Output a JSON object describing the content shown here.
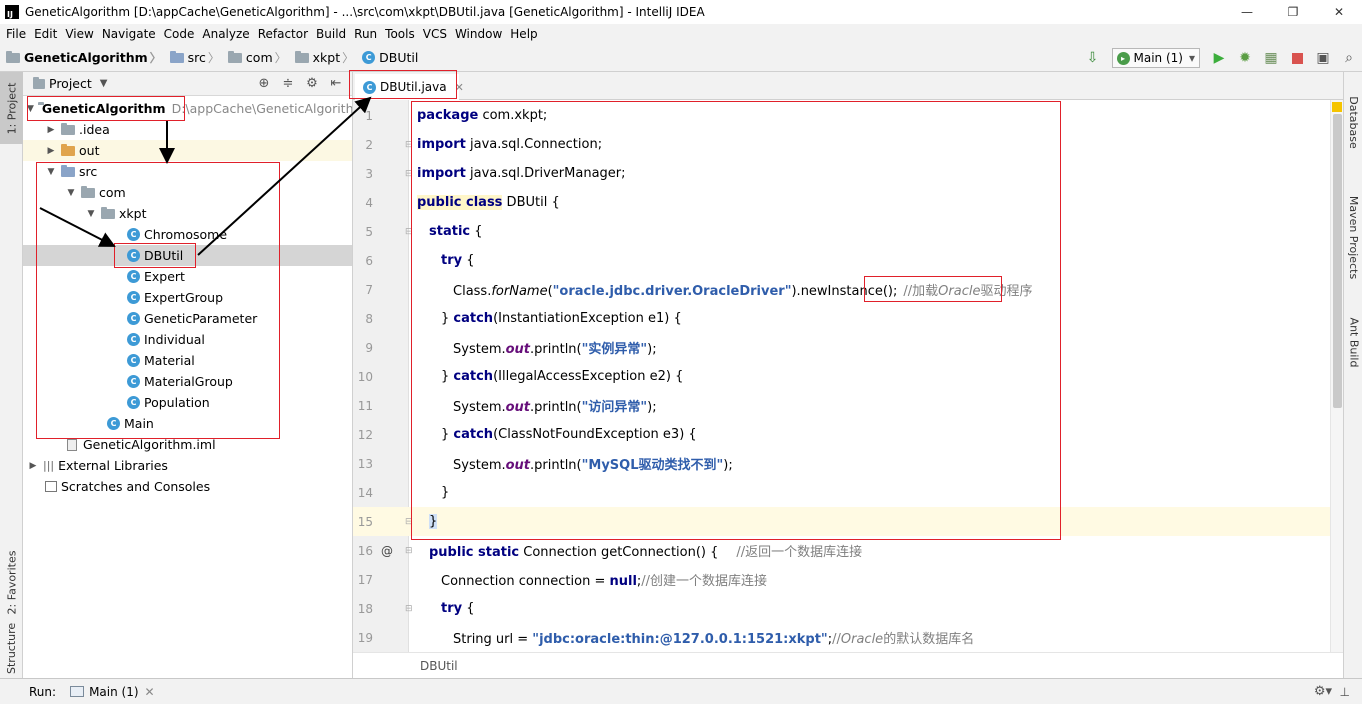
{
  "window": {
    "title": "GeneticAlgorithm [D:\\appCache\\GeneticAlgorithm] - ...\\src\\com\\xkpt\\DBUtil.java [GeneticAlgorithm] - IntelliJ IDEA",
    "app_icon_text": "IJ",
    "minimize": "—",
    "maximize": "❐",
    "close": "✕"
  },
  "menu": [
    "File",
    "Edit",
    "View",
    "Navigate",
    "Code",
    "Analyze",
    "Refactor",
    "Build",
    "Run",
    "Tools",
    "VCS",
    "Window",
    "Help"
  ],
  "breadcrumb": [
    "GeneticAlgorithm",
    "src",
    "com",
    "xkpt",
    "DBUtil"
  ],
  "run_config": {
    "label": "Main (1)"
  },
  "left_tabs": {
    "project": "1: Project",
    "favorites": "2: Favorites",
    "structure": "7: Structure"
  },
  "right_tabs": {
    "database": "Database",
    "maven": "Maven Projects",
    "ant": "Ant Build"
  },
  "project_panel": {
    "title": "Project",
    "tree": [
      {
        "label": "GeneticAlgorithm",
        "path": "D:\\appCache\\GeneticAlgorithm"
      },
      {
        "label": ".idea"
      },
      {
        "label": "out"
      },
      {
        "label": "src"
      },
      {
        "label": "com"
      },
      {
        "label": "xkpt"
      },
      {
        "label": "Chromosome"
      },
      {
        "label": "DBUtil"
      },
      {
        "label": "Expert"
      },
      {
        "label": "ExpertGroup"
      },
      {
        "label": "GeneticParameter"
      },
      {
        "label": "Individual"
      },
      {
        "label": "Material"
      },
      {
        "label": "MaterialGroup"
      },
      {
        "label": "Population"
      },
      {
        "label": "Main"
      },
      {
        "label": "GeneticAlgorithm.iml"
      },
      {
        "label": "External Libraries"
      },
      {
        "label": "Scratches and Consoles"
      }
    ]
  },
  "editor": {
    "tab": "DBUtil.java",
    "breadcrumb_footer": "DBUtil",
    "lines": [
      {
        "n": "1",
        "kw": "package",
        "rest": " com.xkpt;"
      },
      {
        "n": "2",
        "kw": "import",
        "rest": " java.sql.Connection;"
      },
      {
        "n": "3",
        "kw": "import",
        "rest": " java.sql.DriverManager;"
      },
      {
        "n": "4",
        "kw": "public class",
        "rest": " DBUtil {"
      },
      {
        "n": "5",
        "kw": "static",
        "rest": " {"
      },
      {
        "n": "6",
        "kw": "try",
        "rest": " {"
      },
      {
        "n": "7",
        "pre": "Class.",
        "itf": "forName",
        "paren": "(",
        "str": "\"oracle.jdbc.driver.OracleDriver\"",
        "rest": ").newInstance();",
        "comment_a": "//加载",
        "comment_it": "Oracle",
        "comment_b": "驱动程序"
      },
      {
        "n": "8",
        "pre": "} ",
        "kw": "catch",
        "rest": "(InstantiationException e1) {"
      },
      {
        "n": "9",
        "pre": "System.",
        "itf": "out",
        "rest": ".println(",
        "str": "\"实例异常\"",
        "end": ");"
      },
      {
        "n": "10",
        "pre": "} ",
        "kw": "catch",
        "rest": "(IllegalAccessException e2) {"
      },
      {
        "n": "11",
        "pre": "System.",
        "itf": "out",
        "rest": ".println(",
        "str": "\"访问异常\"",
        "end": ");"
      },
      {
        "n": "12",
        "pre": "} ",
        "kw": "catch",
        "rest": "(ClassNotFoundException e3) {"
      },
      {
        "n": "13",
        "pre": "System.",
        "itf": "out",
        "rest": ".println(",
        "str": "\"MySQL驱动类找不到\"",
        "end": ");"
      },
      {
        "n": "14",
        "rest": "}"
      },
      {
        "n": "15",
        "rest": "}"
      },
      {
        "n": "16",
        "kw": "public static",
        "rest": " Connection getConnection() {",
        "comment": "//返回一个数据库连接"
      },
      {
        "n": "17",
        "pre": "Connection connection = ",
        "kw": "null",
        "rest": ";",
        "comment": "//创建一个数据库连接"
      },
      {
        "n": "18",
        "kw": "try",
        "rest": " {"
      },
      {
        "n": "19",
        "pre": "String url = ",
        "str": "\"jdbc:oracle:thin:@127.0.0.1:1521:xkpt\"",
        "rest": ";",
        "comment_a": "//",
        "comment_it": "Oracle",
        "comment_b": "的默认数据库名"
      }
    ]
  },
  "gutter_marks": {
    "override": "@"
  },
  "bottom": {
    "run_label": "Run:",
    "run_tab": "Main (1)"
  },
  "colors": {
    "annotation": "#e0202a",
    "keyword": "#000080",
    "string": "#008000",
    "comment": "#808080"
  }
}
